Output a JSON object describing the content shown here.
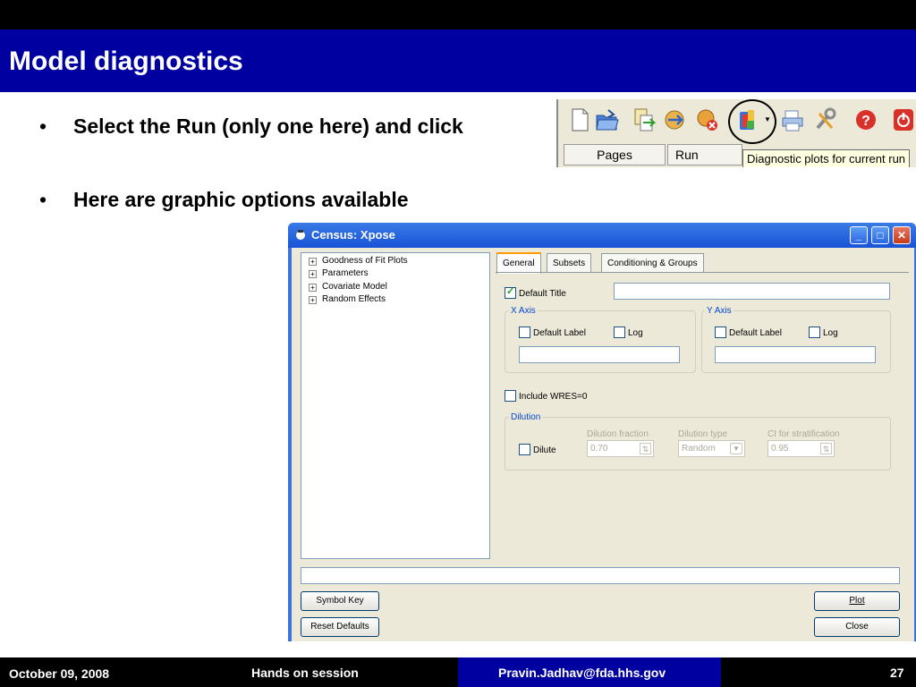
{
  "slide": {
    "title": "Model diagnostics",
    "bullets": [
      "Select the Run (only one here) and click",
      "Here are graphic options available"
    ],
    "bullet_marker": "•"
  },
  "toolbar": {
    "tabs": [
      "Pages",
      "Run"
    ],
    "tooltip": "Diagnostic plots for current run",
    "icons": [
      "new-document-icon",
      "open-folder-icon",
      "copy-icon",
      "export-icon",
      "delete-run-icon",
      "diagnostic-plots-icon",
      "print-icon",
      "tools-icon",
      "help-icon",
      "power-icon"
    ]
  },
  "window": {
    "title": "Census: Xpose",
    "tree": [
      "Goodness of Fit Plots",
      "Parameters",
      "Covariate Model",
      "Random Effects"
    ],
    "tabs": [
      "General",
      "Subsets",
      "Conditioning & Groups"
    ],
    "general": {
      "default_title_label": "Default Title",
      "default_title_checked": true,
      "x_axis": {
        "group": "X Axis",
        "default_label": "Default Label",
        "log": "Log"
      },
      "y_axis": {
        "group": "Y Axis",
        "default_label": "Default Label",
        "log": "Log"
      },
      "include_wres": "Include WRES=0",
      "dilution": {
        "group": "Dilution",
        "dilute": "Dilute",
        "fraction_label": "Dilution fraction",
        "fraction_value": "0.70",
        "type_label": "Dilution type",
        "type_value": "Random",
        "ci_label": "CI for stratification",
        "ci_value": "0.95"
      }
    },
    "buttons": {
      "symbol_key": "Symbol Key",
      "reset_defaults": "Reset Defaults",
      "plot": "Plot",
      "close": "Close"
    }
  },
  "footer": {
    "date": "October 09, 2008",
    "session": "Hands on session",
    "email": "Pravin.Jadhav@fda.hhs.gov",
    "page": "27"
  },
  "colors": {
    "title_bar": "#0000a0",
    "footer": "#000000",
    "window_title": "#1853d6",
    "active_tab": "#ff9a00"
  }
}
